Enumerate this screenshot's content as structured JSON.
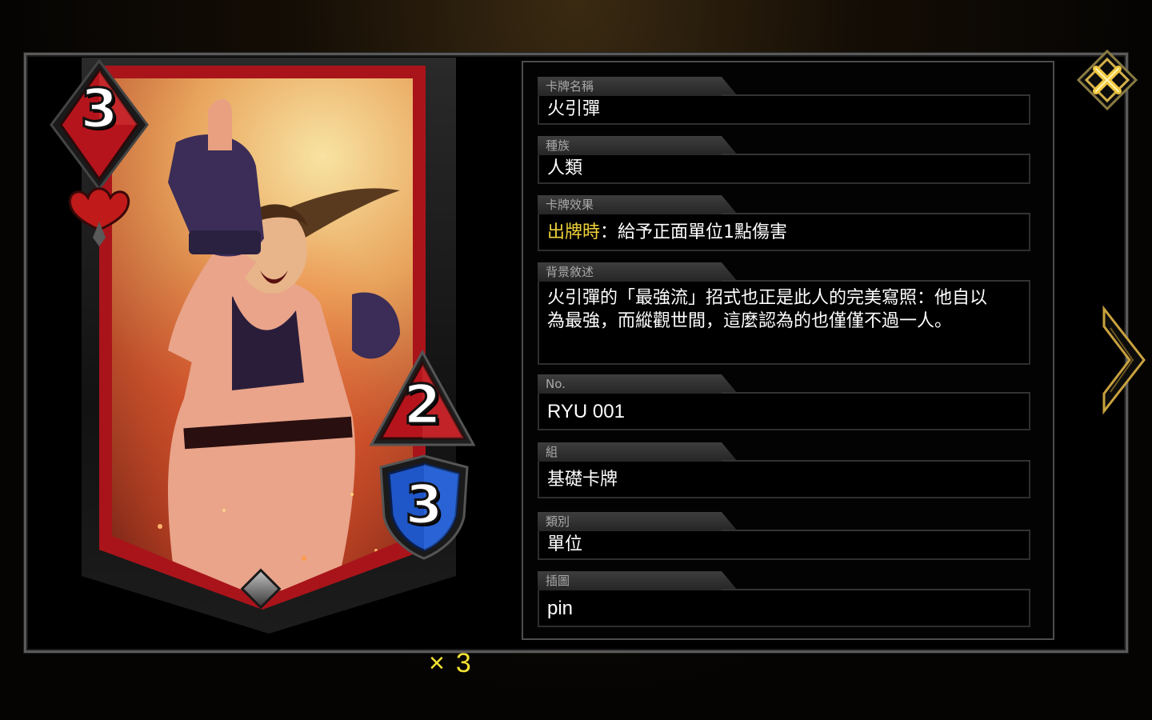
{
  "card": {
    "name": "火引彈",
    "cost": "3",
    "attack": "2",
    "health": "3",
    "copies_symbol": "×",
    "copies_count": "3"
  },
  "details": [
    {
      "key": "card_name",
      "label": "卡牌名稱",
      "value": "火引彈"
    },
    {
      "key": "tribe",
      "label": "種族",
      "value": "人類"
    },
    {
      "key": "effect",
      "label": "卡牌效果",
      "keyword": "出牌時",
      "value": "：給予正面單位1點傷害"
    },
    {
      "key": "lore",
      "label": "背景敘述",
      "value": "火引彈的「最強流」招式也正是此人的完美寫照：他自以為最強，而縱觀世間，這麼認為的也僅僅不過一人。"
    },
    {
      "key": "number",
      "label": "No.",
      "value": "RYU 001"
    },
    {
      "key": "set",
      "label": "組",
      "value": "基礎卡牌"
    },
    {
      "key": "type",
      "label": "類別",
      "value": "單位"
    },
    {
      "key": "illustrator",
      "label": "插圖",
      "value": "pin"
    }
  ],
  "buttons": {
    "close_icon": "close-x-icon",
    "next_icon": "chevron-right-icon"
  },
  "colors": {
    "gold": "#d4b04a",
    "keyword": "#f0d23a",
    "card_red": "#a9141a",
    "health_blue": "#1f56c8"
  }
}
